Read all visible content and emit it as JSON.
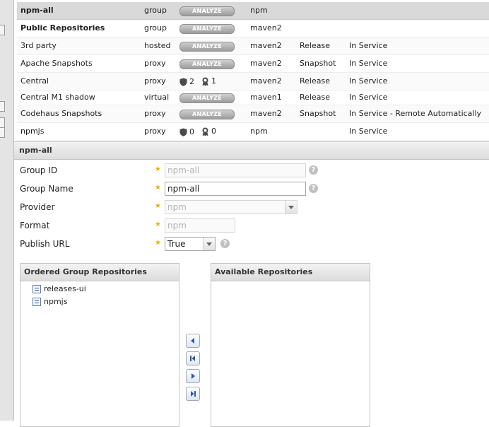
{
  "repositories": [
    {
      "name": "npm-all",
      "type": "group",
      "health": "analyze",
      "format": "npm",
      "policy": "",
      "status": "",
      "bold": true,
      "selected": true
    },
    {
      "name": "Public Repositories",
      "type": "group",
      "health": "analyze",
      "format": "maven2",
      "policy": "",
      "status": "",
      "bold": true
    },
    {
      "name": "3rd party",
      "type": "hosted",
      "health": "analyze",
      "format": "maven2",
      "policy": "Release",
      "status": "In Service"
    },
    {
      "name": "Apache Snapshots",
      "type": "proxy",
      "health": "analyze",
      "format": "maven2",
      "policy": "Snapshot",
      "status": "In Service"
    },
    {
      "name": "Central",
      "type": "proxy",
      "health": "metrics",
      "security": "2",
      "license": "1",
      "format": "maven2",
      "policy": "Release",
      "status": "In Service"
    },
    {
      "name": "Central M1 shadow",
      "type": "virtual",
      "health": "analyze",
      "format": "maven1",
      "policy": "Release",
      "status": "In Service"
    },
    {
      "name": "Codehaus Snapshots",
      "type": "proxy",
      "health": "analyze",
      "format": "maven2",
      "policy": "Snapshot",
      "status": "In Service - Remote Automatically Bl..."
    },
    {
      "name": "npmjs",
      "type": "proxy",
      "health": "metrics",
      "security": "0",
      "license": "0",
      "format": "npm",
      "policy": "",
      "status": "In Service"
    }
  ],
  "analyze_label": "ANALYZE",
  "panel": {
    "title": "npm-all",
    "group_id_label": "Group ID",
    "group_id_value": "npm-all",
    "group_name_label": "Group Name",
    "group_name_value": "npm-all",
    "provider_label": "Provider",
    "provider_value": "npm",
    "format_label": "Format",
    "format_value": "npm",
    "publish_url_label": "Publish URL",
    "publish_url_value": "True",
    "required_mark": "★",
    "help_mark": "?"
  },
  "ordered": {
    "title": "Ordered Group Repositories",
    "items": [
      "releases-ui",
      "npmjs"
    ]
  },
  "available": {
    "title": "Available Repositories",
    "items": []
  },
  "colors": {
    "accent_blue": "#3d64b4",
    "required_star": "#e7b000",
    "selected_row": "#d9d9d9"
  }
}
